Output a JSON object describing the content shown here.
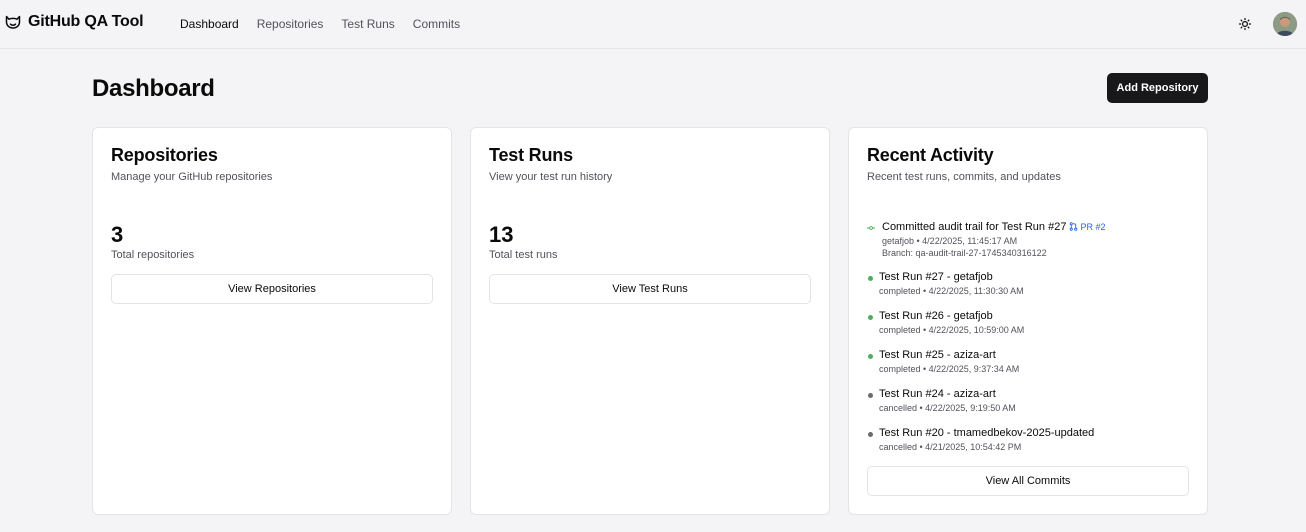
{
  "app": {
    "name": "GitHub QA Tool"
  },
  "nav": {
    "items": [
      {
        "label": "Dashboard",
        "active": true
      },
      {
        "label": "Repositories",
        "active": false
      },
      {
        "label": "Test Runs",
        "active": false
      },
      {
        "label": "Commits",
        "active": false
      }
    ]
  },
  "header": {
    "theme_icon": "sun-icon",
    "avatar_icon": "user-avatar"
  },
  "page": {
    "title": "Dashboard",
    "add_button": "Add Repository"
  },
  "cards": {
    "repositories": {
      "title": "Repositories",
      "description": "Manage your GitHub repositories",
      "count": "3",
      "count_label": "Total repositories",
      "button": "View Repositories"
    },
    "test_runs": {
      "title": "Test Runs",
      "description": "View your test run history",
      "count": "13",
      "count_label": "Total test runs",
      "button": "View Test Runs"
    },
    "activity": {
      "title": "Recent Activity",
      "description": "Recent test runs, commits, and updates",
      "commit": {
        "title": "Committed audit trail for Test Run #27",
        "pr_label": "PR #2",
        "meta": "getafjob • 4/22/2025, 11:45:17 AM",
        "branch": "Branch: qa-audit-trail-27-1745340316122"
      },
      "runs": [
        {
          "title": "Test Run #27 - getafjob",
          "meta": "completed • 4/22/2025, 11:30:30 AM",
          "status": "completed"
        },
        {
          "title": "Test Run #26 - getafjob",
          "meta": "completed • 4/22/2025, 10:59:00 AM",
          "status": "completed"
        },
        {
          "title": "Test Run #25 - aziza-art",
          "meta": "completed • 4/22/2025, 9:37:34 AM",
          "status": "completed"
        },
        {
          "title": "Test Run #24 - aziza-art",
          "meta": "cancelled • 4/22/2025, 9:19:50 AM",
          "status": "cancelled"
        },
        {
          "title": "Test Run #20 - tmamedbekov-2025-updated",
          "meta": "cancelled • 4/21/2025, 10:54:42 PM",
          "status": "cancelled"
        }
      ],
      "button": "View All Commits"
    }
  },
  "colors": {
    "completed": "#4cae5a",
    "cancelled": "#6b6b70",
    "accent": "#18181b",
    "link": "#2563eb"
  }
}
